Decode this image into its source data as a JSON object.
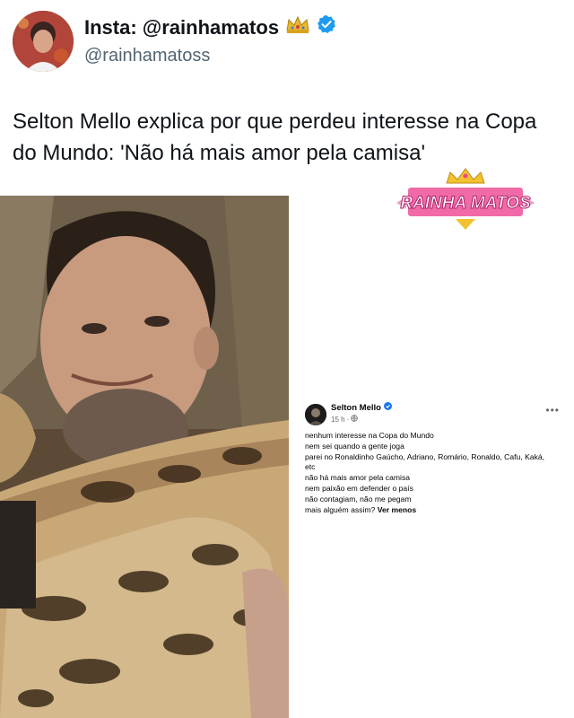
{
  "header": {
    "display_name": "Insta: @rainhamatos",
    "handle": "@rainhamatoss",
    "crown_icon": "crown-icon",
    "verified_icon": "verified-badge-icon",
    "verified_color": "#1d9bf0"
  },
  "tweet": {
    "text": "Selton Mello explica por que perdeu interesse na Copa do Mundo: 'Não há mais amor pela camisa'"
  },
  "logo": {
    "text": "RAINHA MATOS"
  },
  "fb_post": {
    "author": "Selton Mello",
    "time": "15 h",
    "lines": [
      "nenhum interesse na Copa do Mundo",
      "nem sei quando a gente joga",
      "parei no Ronaldinho Gaúcho, Adriano, Romário, Ronaldo, Cafu, Kaká,",
      "etc",
      "não há mais amor pela camisa",
      "nem paixão em defender o país",
      "não contagiam, não me pegam",
      "mais alguém assim?"
    ],
    "see_less": "Ver menos",
    "more_icon": "more-options-icon",
    "globe_icon": "globe-icon"
  }
}
